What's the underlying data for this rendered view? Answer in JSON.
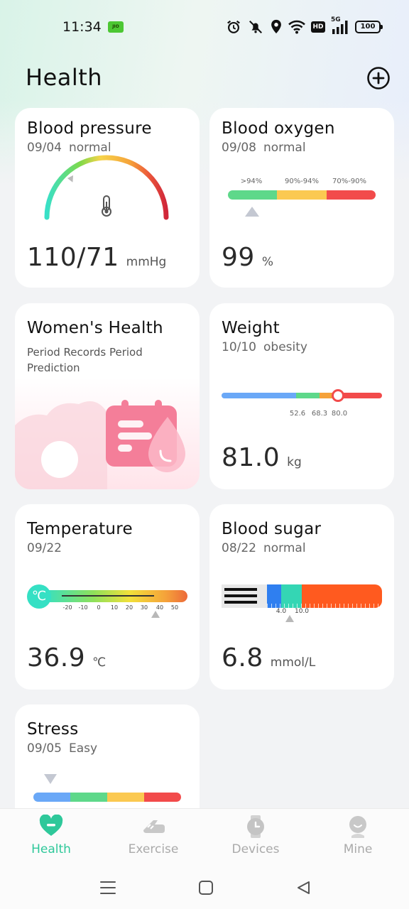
{
  "status_bar": {
    "time": "11:34",
    "carrier_badge": "JIO",
    "network": "5G",
    "hd": "HD",
    "battery": "100"
  },
  "header": {
    "title": "Health"
  },
  "cards": {
    "blood_pressure": {
      "title": "Blood pressure",
      "date": "09/04",
      "status": "normal",
      "value": "110/71",
      "unit": "mmHg"
    },
    "blood_oxygen": {
      "title": "Blood oxygen",
      "date": "09/08",
      "status": "normal",
      "value": "99",
      "unit": "%",
      "ranges": [
        ">94%",
        "90%-94%",
        "70%-90%"
      ],
      "colors": [
        "#5ed88a",
        "#fbc951",
        "#f24b4b"
      ]
    },
    "womens_health": {
      "title": "Women's Health",
      "description": "Period Records Period Prediction"
    },
    "weight": {
      "title": "Weight",
      "date": "10/10",
      "status": "obesity",
      "value": "81.0",
      "unit": "kg",
      "ticks": [
        "52.6",
        "68.3",
        "80.0"
      ]
    },
    "temperature": {
      "title": "Temperature",
      "date": "09/22",
      "value": "36.9",
      "unit": "℃",
      "icon_symbol": "℃",
      "ticks": [
        "-20",
        "-10",
        "0",
        "10",
        "20",
        "30",
        "40",
        "50"
      ]
    },
    "blood_sugar": {
      "title": "Blood sugar",
      "date": "08/22",
      "status": "normal",
      "value": "6.8",
      "unit": "mmol/L",
      "ticks": [
        "4.0",
        "10.0"
      ]
    },
    "stress": {
      "title": "Stress",
      "date": "09/05",
      "status": "Easy",
      "colors": [
        "#6aa8f7",
        "#5ed88a",
        "#fbc951",
        "#f24b4b"
      ]
    }
  },
  "bottom_nav": {
    "items": [
      {
        "label": "Health",
        "icon": "heart-icon",
        "active": true
      },
      {
        "label": "Exercise",
        "icon": "running-shoe-icon",
        "active": false
      },
      {
        "label": "Devices",
        "icon": "watch-icon",
        "active": false
      },
      {
        "label": "Mine",
        "icon": "profile-icon",
        "active": false
      }
    ]
  },
  "colors": {
    "accent": "#2ec89a",
    "background": "#f2f3f5",
    "card": "#ffffff"
  }
}
